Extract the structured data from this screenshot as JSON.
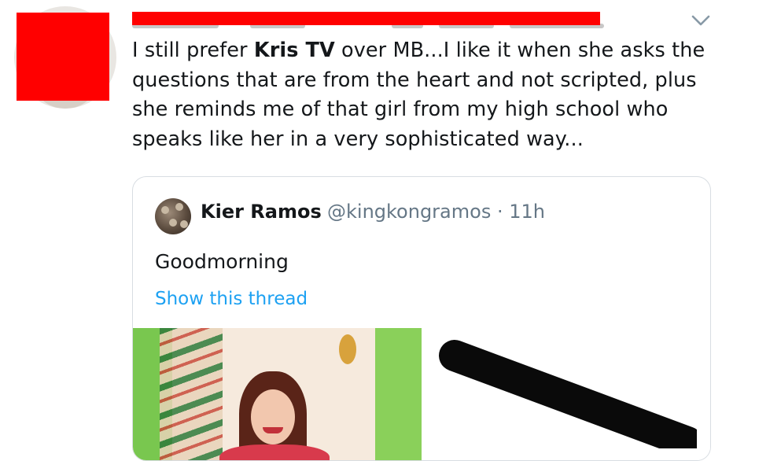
{
  "tweet": {
    "text_before": "I still prefer ",
    "text_bold": "Kris TV",
    "text_after": " over MB...I like it when she asks the questions that are from the heart and not scripted, plus she reminds me of that girl from my high school who speaks like her in a very sophisticated way...",
    "menu_icon": "chevron-down-icon"
  },
  "quoted": {
    "name": "Kier Ramos",
    "handle_time": "@kingkongramos · 11h",
    "body": "Goodmorning",
    "thread_link": "Show this thread"
  },
  "colors": {
    "redaction": "#ff0000",
    "link": "#1da1f2",
    "secondary_text": "#657786",
    "border": "#d8dde2"
  }
}
